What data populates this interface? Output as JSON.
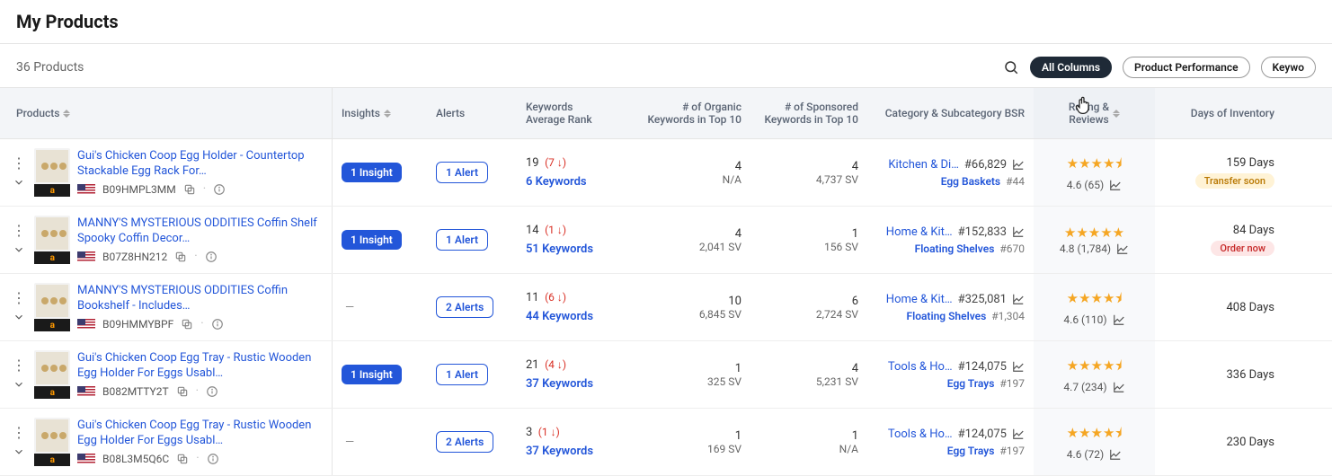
{
  "page": {
    "title": "My Products",
    "count_label": "36 Products"
  },
  "filters": {
    "all_columns": "All Columns",
    "product_performance": "Product Performance",
    "keywords": "Keywo"
  },
  "columns": {
    "products": "Products",
    "insights": "Insights",
    "alerts": "Alerts",
    "keywords_l1": "Keywords",
    "keywords_l2": "Average Rank",
    "organic_l1": "# of Organic",
    "organic_l2": "Keywords in Top 10",
    "sponsored_l1": "# of Sponsored",
    "sponsored_l2": "Keywords in Top 10",
    "category": "Category & Subcategory BSR",
    "rating_l1": "Rating &",
    "rating_l2": "Reviews",
    "inventory": "Days of Inventory"
  },
  "labels": {
    "insight_one": "1 Insight",
    "alert_one": "1 Alert",
    "alerts_two": "2 Alerts",
    "dash": "—",
    "transfer_soon": "Transfer soon",
    "order_now": "Order now"
  },
  "rows": [
    {
      "title": "Gui's Chicken Coop Egg Holder - Countertop Stackable Egg Rack For…",
      "asin": "B09HMPL3MM",
      "insight": "1 Insight",
      "alert": "1 Alert",
      "kw_rank": "19",
      "kw_change": "(7 ↓)",
      "kw_count": "6 Keywords",
      "organic_main": "4",
      "organic_sub": "N/A",
      "sponsored_main": "4",
      "sponsored_sub": "4,737 SV",
      "cat_name": "Kitchen & Di…",
      "cat_rank": "#66,829",
      "subcat_name": "Egg Baskets",
      "subcat_rank": "#44",
      "stars": "★★★★⯨",
      "rating_text": "4.6 (65)",
      "inv_days": "159 Days",
      "inv_chip": "Transfer soon",
      "inv_chip_class": "chip-warn"
    },
    {
      "title": "MANNY'S MYSTERIOUS ODDITIES Coffin Shelf Spooky Coffin Decor…",
      "asin": "B07Z8HN212",
      "insight": "1 Insight",
      "alert": "1 Alert",
      "kw_rank": "14",
      "kw_change": "(1 ↓)",
      "kw_count": "51 Keywords",
      "organic_main": "4",
      "organic_sub": "2,041 SV",
      "sponsored_main": "1",
      "sponsored_sub": "156 SV",
      "cat_name": "Home & Kit…",
      "cat_rank": "#152,833",
      "subcat_name": "Floating Shelves",
      "subcat_rank": "#670",
      "stars": "★★★★★",
      "rating_text": "4.8 (1,784)",
      "inv_days": "84 Days",
      "inv_chip": "Order now",
      "inv_chip_class": "chip-error"
    },
    {
      "title": "MANNY'S MYSTERIOUS ODDITIES Coffin Bookshelf - Includes…",
      "asin": "B09HMMYBPF",
      "insight": "—",
      "alert": "2 Alerts",
      "kw_rank": "11",
      "kw_change": "(6 ↓)",
      "kw_count": "44 Keywords",
      "organic_main": "10",
      "organic_sub": "6,845 SV",
      "sponsored_main": "6",
      "sponsored_sub": "2,724 SV",
      "cat_name": "Home & Kit…",
      "cat_rank": "#325,081",
      "subcat_name": "Floating Shelves",
      "subcat_rank": "#1,304",
      "stars": "★★★★⯨",
      "rating_text": "4.6 (110)",
      "inv_days": "408 Days",
      "inv_chip": "",
      "inv_chip_class": ""
    },
    {
      "title": "Gui's Chicken Coop Egg Tray - Rustic Wooden Egg Holder For Eggs Usabl…",
      "asin": "B082MTTY2T",
      "insight": "1 Insight",
      "alert": "1 Alert",
      "kw_rank": "21",
      "kw_change": "(4 ↓)",
      "kw_count": "37 Keywords",
      "organic_main": "1",
      "organic_sub": "325 SV",
      "sponsored_main": "4",
      "sponsored_sub": "5,231 SV",
      "cat_name": "Tools & Ho…",
      "cat_rank": "#124,075",
      "subcat_name": "Egg Trays",
      "subcat_rank": "#197",
      "stars": "★★★★⯨",
      "rating_text": "4.7 (234)",
      "inv_days": "336 Days",
      "inv_chip": "",
      "inv_chip_class": ""
    },
    {
      "title": "Gui's Chicken Coop Egg Tray - Rustic Wooden Egg Holder For Eggs Usabl…",
      "asin": "B08L3M5Q6C",
      "insight": "—",
      "alert": "2 Alerts",
      "kw_rank": "3",
      "kw_change": "(1 ↓)",
      "kw_count": "37 Keywords",
      "organic_main": "1",
      "organic_sub": "169 SV",
      "sponsored_main": "1",
      "sponsored_sub": "N/A",
      "cat_name": "Tools & Ho…",
      "cat_rank": "#124,075",
      "subcat_name": "Egg Trays",
      "subcat_rank": "#197",
      "stars": "★★★★⯨",
      "rating_text": "4.6 (72)",
      "inv_days": "230 Days",
      "inv_chip": "",
      "inv_chip_class": ""
    }
  ]
}
